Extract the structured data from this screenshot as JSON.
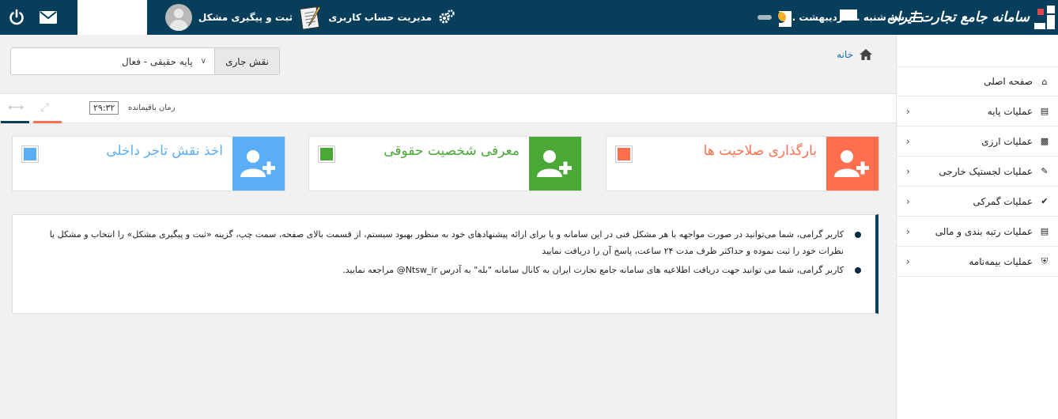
{
  "header": {
    "logo_text": "سامانه جامع تجارت ایران",
    "date_text": "سه شنبه ... اردیبهشت ...",
    "account_label": "مدیریت حساب کاربری",
    "report_label": "ثبت و پیگیری مشکل"
  },
  "sidebar": {
    "items": [
      {
        "label": "صفحه اصلی",
        "icon": "home-icon"
      },
      {
        "label": "عملیات پایه",
        "icon": "bar-chart-icon"
      },
      {
        "label": "عملیات ارزی",
        "icon": "money-icon"
      },
      {
        "label": "عملیات لجستیک خارجی",
        "icon": "edit-icon"
      },
      {
        "label": "عملیات گمرکی",
        "icon": "check-icon"
      },
      {
        "label": "عملیات رتبه بندی و مالی",
        "icon": "bar-chart-icon"
      },
      {
        "label": "عملیات بیمه‌نامه",
        "icon": "shield-icon"
      }
    ]
  },
  "breadcrumb": {
    "home": "خانه"
  },
  "role": {
    "label": "نقش جاری",
    "value": "پایه حقیقی - فعال"
  },
  "timer": {
    "label": "زمان باقیمانده",
    "value": "۲۹:۳۲"
  },
  "cards": [
    {
      "title": "بارگذاری صلاحیت ها",
      "color": "#ff6f4e",
      "sq": "#ff6f4e"
    },
    {
      "title": "معرفی شخصیت حقوقی",
      "color": "#49a836",
      "sq": "#49a836"
    },
    {
      "title": "اخذ نقش تاجر داخلی",
      "color": "#5aaef5",
      "sq": "#5aaef5"
    }
  ],
  "notices": [
    "کاربر گرامی، شما می‌توانید در صورت مواجهه با هر مشکل فنی در این سامانه و یا برای ارائه پیشنهادهای خود به منظور بهبود سیستم، از قسمت بالای صفحه، سمت چپ، گزینه «ثبت و پیگیری مشکل» را انتخاب و مشکل یا نظرات خود را ثبت نموده و حداکثر ظرف مدت ۲۴ ساعت، پاسخ آن را دریافت نمایید",
    "کاربر گرامی، شما می توانید جهت دریافت اطلاعیه های سامانه جامع تجارت ایران به کانال سامانه \"بله\" به آدرس Ntsw_ir@ مراجعه نمایید."
  ]
}
